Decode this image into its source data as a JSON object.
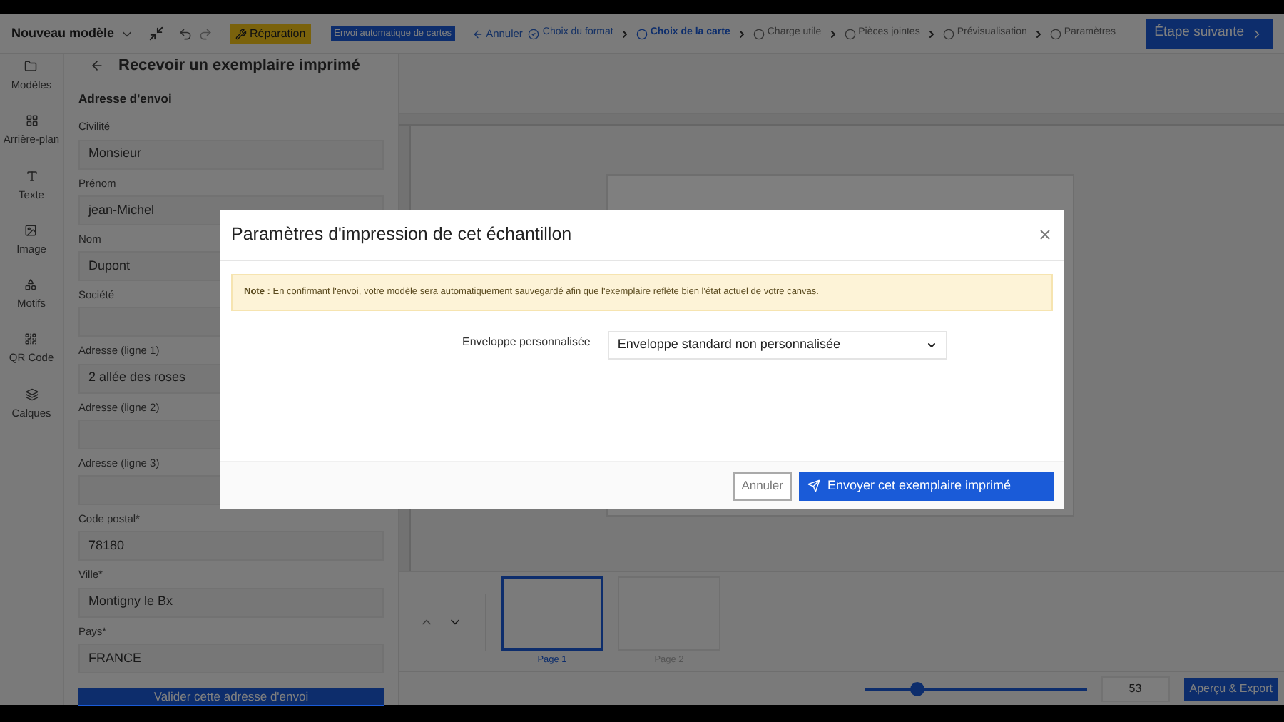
{
  "toolbar": {
    "model_name": "Nouveau modèle",
    "repair_button": "Réparation",
    "auto_badge": "Envoi automatique de cartes",
    "cancel_link": "Annuler",
    "steps": [
      {
        "label": "Choix du format",
        "done": true,
        "selected": false
      },
      {
        "label": "Choix de la carte",
        "done": false,
        "selected": true
      },
      {
        "label": "Charge utile",
        "done": false,
        "selected": false
      },
      {
        "label": "Pièces jointes",
        "done": false,
        "selected": false
      },
      {
        "label": "Prévisualisation",
        "done": false,
        "selected": false
      },
      {
        "label": "Paramètres",
        "done": false,
        "selected": false
      }
    ],
    "next_button": "Étape suivante"
  },
  "sidebar": {
    "items": [
      {
        "kind": "folder",
        "label": "Modèles"
      },
      {
        "kind": "grid",
        "label": "Arrière-plan"
      },
      {
        "kind": "text",
        "label": "Texte"
      },
      {
        "kind": "image",
        "label": "Image"
      },
      {
        "kind": "shapes",
        "label": "Motifs"
      },
      {
        "kind": "qr",
        "label": "QR Code"
      },
      {
        "kind": "layers",
        "label": "Calques"
      }
    ]
  },
  "panel": {
    "title": "Recevoir un exemplaire imprimé",
    "section": "Adresse d'envoi",
    "fields": [
      {
        "label": "Civilité",
        "value": "Monsieur"
      },
      {
        "label": "Prénom",
        "value": "jean-Michel"
      },
      {
        "label": "Nom",
        "value": "Dupont"
      },
      {
        "label": "Société"
      },
      {
        "label": "Adresse (ligne 1)",
        "value": "2 allée des roses"
      },
      {
        "label": "Adresse (ligne 2)"
      },
      {
        "label": "Adresse (ligne 3)"
      },
      {
        "label": "Code postal*",
        "value": "78180"
      },
      {
        "label": "Ville*",
        "value": "Montigny le Bx"
      },
      {
        "label": "Pays*",
        "value": "FRANCE"
      }
    ],
    "submit_button": "Valider cette adresse d'envoi"
  },
  "pages": [
    {
      "label": "Page 1",
      "selected": true
    },
    {
      "label": "Page 2",
      "selected": false
    }
  ],
  "zoom": {
    "level": 0.24,
    "value": "53"
  },
  "export_button": "Aperçu & Export",
  "dialog": {
    "title": "Paramètres d'impression de cet échantillon",
    "note": "**Note :** En confirmant l'envoi, votre modèle sera automatiquement sauvegardé afin que l'exemplaire reflète bien l'état actuel de votre canvas.",
    "envelope_label": "Enveloppe personnalisée",
    "envelope_value": "Enveloppe standard non personnalisée",
    "cancel_button": "Annuler",
    "send_button": "Envoyer cet exemplaire imprimé"
  }
}
